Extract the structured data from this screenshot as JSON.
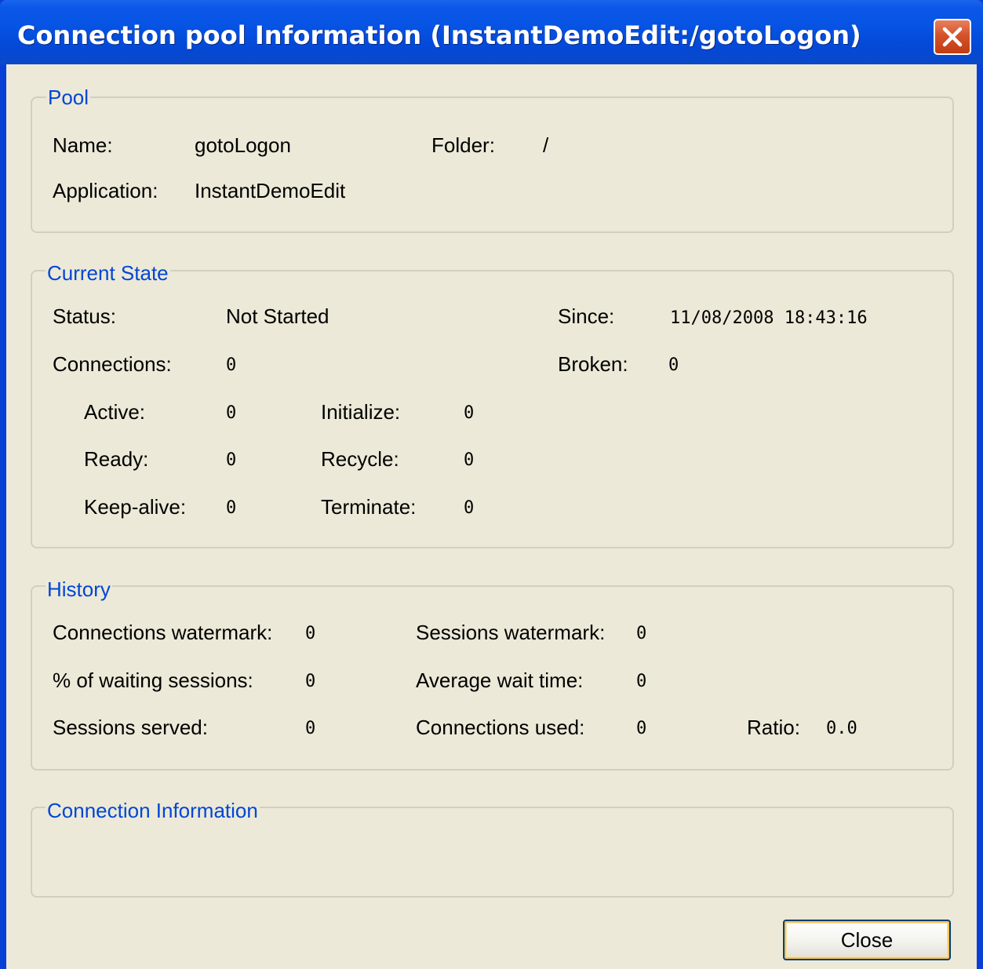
{
  "window": {
    "title": "Connection pool Information (InstantDemoEdit:/gotoLogon)"
  },
  "pool": {
    "label": "Pool",
    "name_label": "Name:",
    "name_value": "gotoLogon",
    "folder_label": "Folder:",
    "folder_value": "/",
    "application_label": "Application:",
    "application_value": "InstantDemoEdit"
  },
  "current_state": {
    "label": "Current State",
    "status_label": "Status:",
    "status_value": "Not Started",
    "since_label": "Since:",
    "since_value": "11/08/2008 18:43:16",
    "connections_label": "Connections:",
    "connections_value": "0",
    "broken_label": "Broken:",
    "broken_value": "0",
    "active_label": "Active:",
    "active_value": "0",
    "initialize_label": "Initialize:",
    "initialize_value": "0",
    "ready_label": "Ready:",
    "ready_value": "0",
    "recycle_label": "Recycle:",
    "recycle_value": "0",
    "keepalive_label": "Keep-alive:",
    "keepalive_value": "0",
    "terminate_label": "Terminate:",
    "terminate_value": "0"
  },
  "history": {
    "label": "History",
    "conn_watermark_label": "Connections watermark:",
    "conn_watermark_value": "0",
    "sess_watermark_label": "Sessions watermark:",
    "sess_watermark_value": "0",
    "waiting_label": "% of waiting sessions:",
    "waiting_value": "0",
    "avg_wait_label": "Average wait time:",
    "avg_wait_value": "0",
    "served_label": "Sessions served:",
    "served_value": "0",
    "used_label": "Connections used:",
    "used_value": "0",
    "ratio_label": "Ratio:",
    "ratio_value": "0.0"
  },
  "connection_info": {
    "label": "Connection Information"
  },
  "buttons": {
    "close_label": "Close"
  },
  "colors": {
    "titlebar": "#0653e4",
    "dialog_bg": "#ece9d8",
    "group_label": "#0046d5",
    "close_icon_bg": "#d4532a"
  },
  "icons": {
    "close": "close-icon"
  }
}
